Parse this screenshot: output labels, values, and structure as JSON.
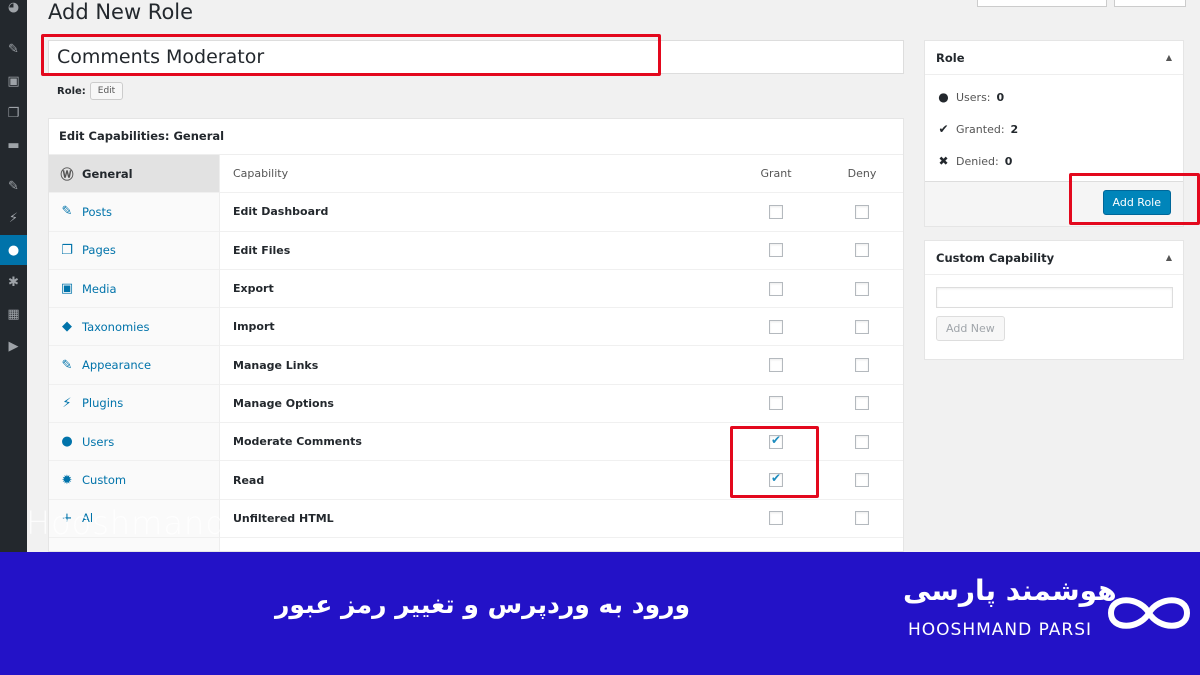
{
  "page": {
    "title": "Add New Role"
  },
  "role_name": {
    "value": "Comments Moderator"
  },
  "role_slug": {
    "label": "Role:",
    "edit_label": "Edit"
  },
  "capabilities": {
    "heading": "Edit Capabilities: General",
    "nav": [
      {
        "label": "General",
        "icon": "wordpress-icon",
        "active": true
      },
      {
        "label": "Posts",
        "icon": "pin-icon"
      },
      {
        "label": "Pages",
        "icon": "pages-icon"
      },
      {
        "label": "Media",
        "icon": "media-icon"
      },
      {
        "label": "Taxonomies",
        "icon": "tag-icon"
      },
      {
        "label": "Appearance",
        "icon": "brush-icon"
      },
      {
        "label": "Plugins",
        "icon": "plug-icon"
      },
      {
        "label": "Users",
        "icon": "user-icon"
      },
      {
        "label": "Custom",
        "icon": "gear-icon"
      },
      {
        "label": "Al",
        "icon": "plus-icon"
      }
    ],
    "columns": {
      "capability": "Capability",
      "grant": "Grant",
      "deny": "Deny"
    },
    "rows": [
      {
        "name": "Edit Dashboard",
        "grant": false,
        "deny": false
      },
      {
        "name": "Edit Files",
        "grant": false,
        "deny": false
      },
      {
        "name": "Export",
        "grant": false,
        "deny": false
      },
      {
        "name": "Import",
        "grant": false,
        "deny": false
      },
      {
        "name": "Manage Links",
        "grant": false,
        "deny": false
      },
      {
        "name": "Manage Options",
        "grant": false,
        "deny": false
      },
      {
        "name": "Moderate Comments",
        "grant": true,
        "deny": false
      },
      {
        "name": "Read",
        "grant": true,
        "deny": false
      },
      {
        "name": "Unfiltered HTML",
        "grant": false,
        "deny": false
      }
    ]
  },
  "role_box": {
    "title": "Role",
    "users_label": "Users:",
    "users_value": "0",
    "granted_label": "Granted:",
    "granted_value": "2",
    "denied_label": "Denied:",
    "denied_value": "0",
    "submit_label": "Add Role"
  },
  "custom_capability": {
    "title": "Custom Capability",
    "input_value": "",
    "add_label": "Add New"
  },
  "watermark": "Hooshmand",
  "banner": {
    "caption": "ورود به وردپرس و تغییر رمز عبور",
    "brand_fa": "هوشمند پارسی",
    "brand_en": "HOOSHMAND PARSI",
    "accent": "#2312c7"
  }
}
